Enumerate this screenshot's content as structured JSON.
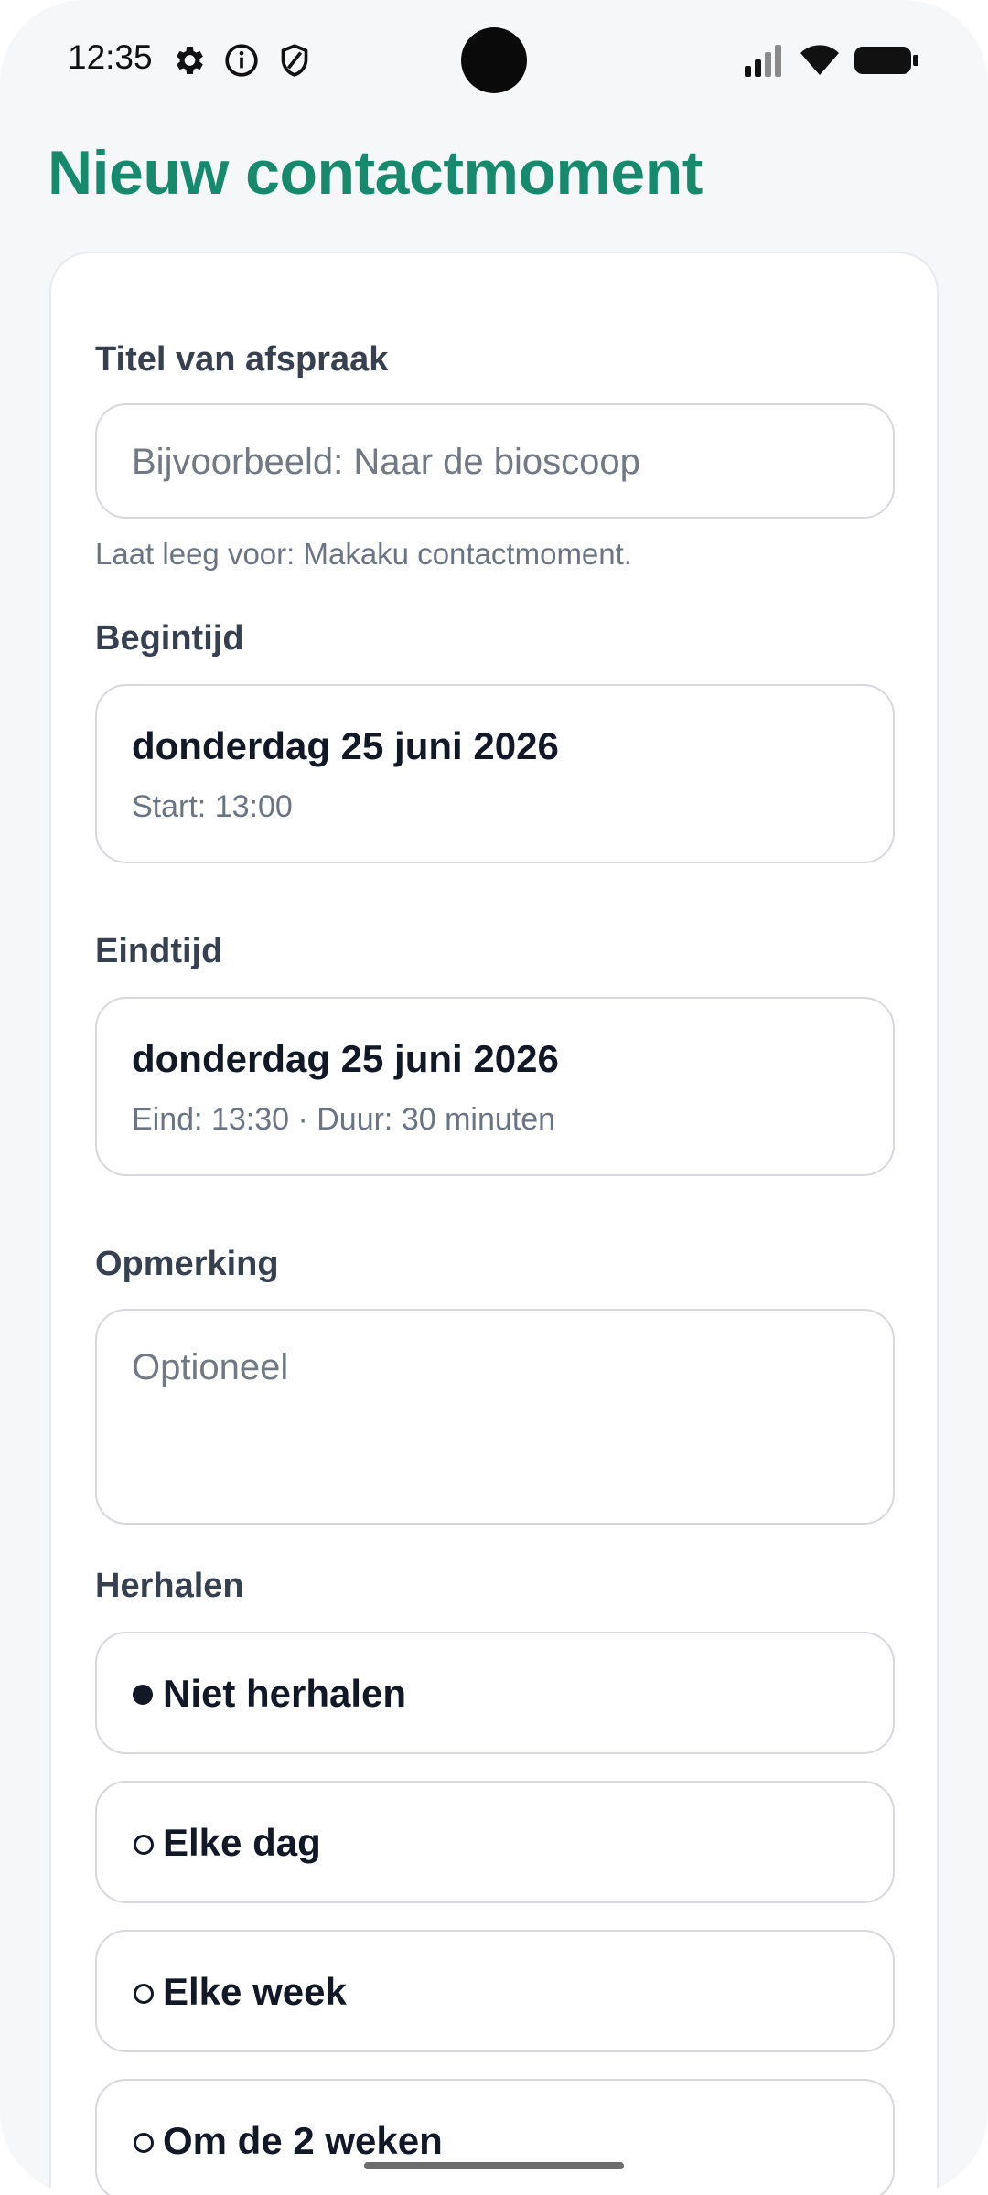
{
  "status_bar": {
    "time": "12:35",
    "icons": [
      "gear-icon",
      "info-icon",
      "shield-icon",
      "signal-icon",
      "wifi-icon",
      "battery-icon"
    ]
  },
  "page": {
    "title": "Nieuw contactmoment",
    "accent_color": "#178a6e"
  },
  "form": {
    "title_field": {
      "label": "Titel van afspraak",
      "placeholder": "Bijvoorbeeld: Naar de bioscoop",
      "value": "",
      "hint": "Laat leeg voor: Makaku contactmoment."
    },
    "start": {
      "label": "Begintijd",
      "date": "donderdag 25 juni 2026",
      "detail": "Start: 13:00"
    },
    "end": {
      "label": "Eindtijd",
      "date": "donderdag 25 juni 2026",
      "detail": "Eind: 13:30 · Duur: 30 minuten"
    },
    "note": {
      "label": "Opmerking",
      "placeholder": "Optioneel",
      "value": ""
    },
    "repeat": {
      "label": "Herhalen",
      "selected": "Niet herhalen",
      "options": [
        {
          "label": "Niet herhalen",
          "selected": true
        },
        {
          "label": "Elke dag",
          "selected": false
        },
        {
          "label": "Elke week",
          "selected": false
        },
        {
          "label": "Om de 2 weken",
          "selected": false
        }
      ]
    }
  }
}
